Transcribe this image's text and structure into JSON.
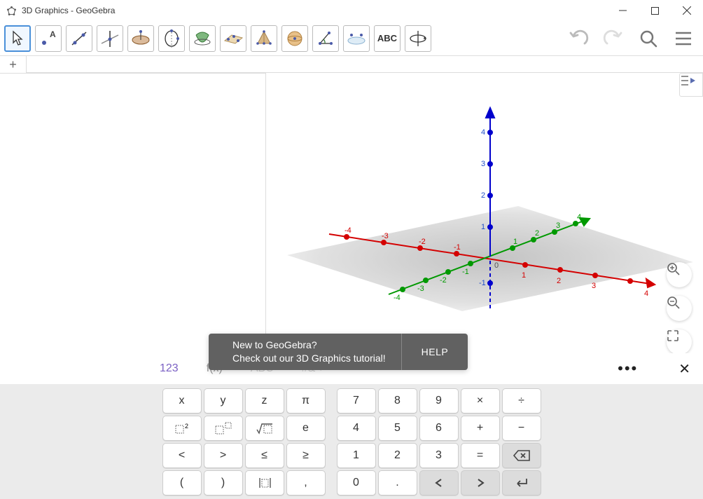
{
  "window": {
    "title": "3D Graphics - GeoGebra"
  },
  "toolbar": {
    "tools": [
      {
        "name": "move-tool",
        "selected": true
      },
      {
        "name": "point-tool"
      },
      {
        "name": "line-tool"
      },
      {
        "name": "perpendicular-tool"
      },
      {
        "name": "polygon-tool"
      },
      {
        "name": "circle-axis-tool"
      },
      {
        "name": "intersect-curves-tool"
      },
      {
        "name": "plane-3points-tool"
      },
      {
        "name": "pyramid-tool"
      },
      {
        "name": "sphere-tool"
      },
      {
        "name": "angle-tool"
      },
      {
        "name": "reflect-tool"
      },
      {
        "name": "text-tool",
        "label": "ABC"
      },
      {
        "name": "rotate-view-tool"
      }
    ],
    "undo": "Undo",
    "redo": "Redo",
    "search": "Search",
    "menu": "Menu"
  },
  "tutorial": {
    "line1": "New to GeoGebra?",
    "line2": "Check out our 3D Graphics tutorial!",
    "help": "HELP"
  },
  "axes": {
    "x": {
      "color": "#d40000",
      "ticks": [
        -4,
        -3,
        -2,
        -1,
        1,
        2,
        3,
        4
      ]
    },
    "y": {
      "color": "#009900",
      "ticks": [
        -4,
        -3,
        -2,
        -1,
        1,
        2,
        3,
        4
      ]
    },
    "z": {
      "color": "#0000cc",
      "ticks": [
        -1,
        1,
        2,
        3,
        4
      ]
    },
    "origin": "0"
  },
  "keyboardTabs": {
    "123": "123",
    "fx": "f(x)",
    "abc": "ABC",
    "sym": "#&¬"
  },
  "keyboard": {
    "left": [
      [
        "x",
        "y",
        "z",
        "π"
      ],
      [
        "☐²",
        "☐^☐",
        "√☐",
        "e"
      ],
      [
        "<",
        ">",
        "≤",
        "≥"
      ],
      [
        "(",
        ")",
        "|☐|",
        ","
      ]
    ],
    "right": [
      [
        "7",
        "8",
        "9",
        "×",
        "÷"
      ],
      [
        "4",
        "5",
        "6",
        "+",
        "−"
      ],
      [
        "1",
        "2",
        "3",
        "=",
        "⌫"
      ],
      [
        "0",
        ".",
        "◂",
        "▸",
        "↵"
      ]
    ]
  }
}
